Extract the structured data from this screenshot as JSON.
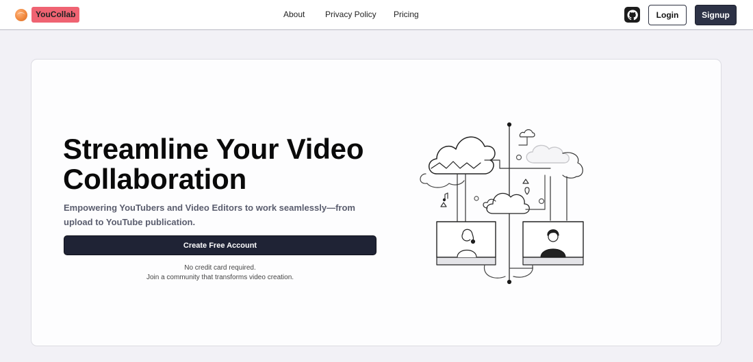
{
  "app": {
    "brand": "YouCollab"
  },
  "nav": {
    "links": [
      {
        "label": "About"
      },
      {
        "label": "Privacy Policy"
      },
      {
        "label": "Pricing"
      }
    ],
    "github_icon": "github-icon",
    "login_label": "Login",
    "signup_label": "Signup"
  },
  "hero": {
    "title": "Streamline Your Video Collaboration",
    "subtitle": "Empowering YouTubers and Video Editors to work seamlessly—from upload to YouTube publication.",
    "cta_label": "Create Free Account",
    "note_line1": "No credit card required.",
    "note_line2": "Join a community that transforms video creation."
  },
  "colors": {
    "brand_badge": "#ef6372",
    "primary_dark": "#2d3246",
    "cta": "#1f2335",
    "background": "#f2f1f6"
  }
}
